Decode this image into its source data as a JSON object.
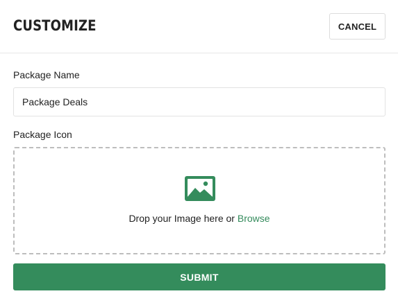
{
  "header": {
    "title": "CUSTOMIZE",
    "cancel_label": "CANCEL"
  },
  "form": {
    "package_name": {
      "label": "Package Name",
      "value": "Package Deals"
    },
    "package_icon": {
      "label": "Package Icon",
      "icon": "image-icon",
      "drop_text": "Drop your Image here or",
      "browse_label": "Browse"
    },
    "submit_label": "SUBMIT"
  },
  "colors": {
    "accent": "#348c5c",
    "link": "#338a5b",
    "text": "#222222",
    "border": "#e2e2e2"
  }
}
